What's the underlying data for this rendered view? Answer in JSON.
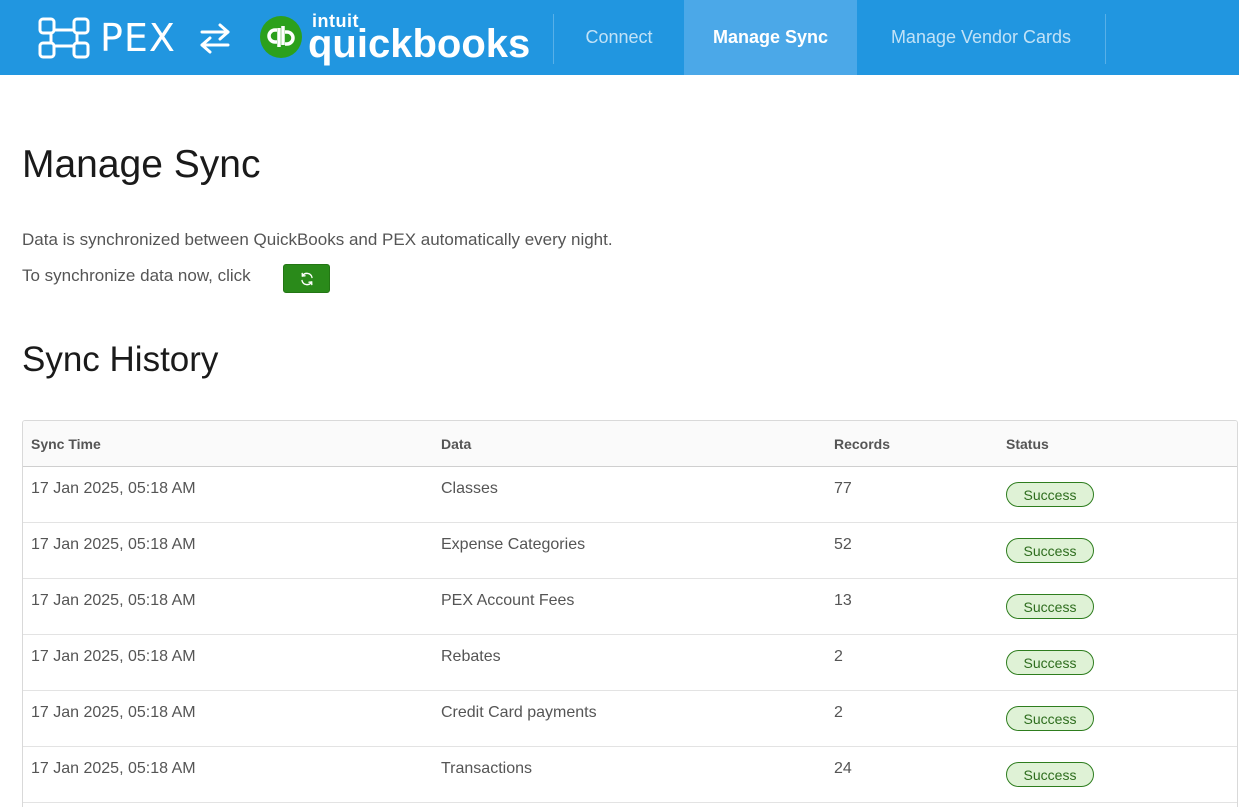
{
  "header": {
    "pex_brand": "PEX",
    "intuit_brand": "intuit",
    "qb_brand": "quickbooks",
    "nav": [
      {
        "label": "Connect",
        "active": false
      },
      {
        "label": "Manage Sync",
        "active": true
      },
      {
        "label": "Manage Vendor Cards",
        "active": false
      }
    ]
  },
  "main": {
    "title": "Manage Sync",
    "description": "Data is synchronized between QuickBooks and PEX automatically every night.",
    "sync_prompt": "To synchronize data now, click",
    "sync_button_icon": "refresh-icon",
    "history_title": "Sync History"
  },
  "table": {
    "columns": [
      "Sync Time",
      "Data",
      "Records",
      "Status"
    ],
    "rows": [
      {
        "time": "17 Jan 2025, 05:18 AM",
        "data": "Classes",
        "records": "77",
        "status": "Success"
      },
      {
        "time": "17 Jan 2025, 05:18 AM",
        "data": "Expense Categories",
        "records": "52",
        "status": "Success"
      },
      {
        "time": "17 Jan 2025, 05:18 AM",
        "data": "PEX Account Fees",
        "records": "13",
        "status": "Success"
      },
      {
        "time": "17 Jan 2025, 05:18 AM",
        "data": "Rebates",
        "records": "2",
        "status": "Success"
      },
      {
        "time": "17 Jan 2025, 05:18 AM",
        "data": "Credit Card payments",
        "records": "2",
        "status": "Success"
      },
      {
        "time": "17 Jan 2025, 05:18 AM",
        "data": "Transactions",
        "records": "24",
        "status": "Success"
      }
    ]
  },
  "colors": {
    "header_bg": "#2196e0",
    "nav_active_bg": "#4ba8e8",
    "qb_green": "#2ca01c",
    "sync_button": "#2a8a1a",
    "success_badge_bg": "#dff2d6",
    "success_badge_border": "#2e7d1e"
  }
}
